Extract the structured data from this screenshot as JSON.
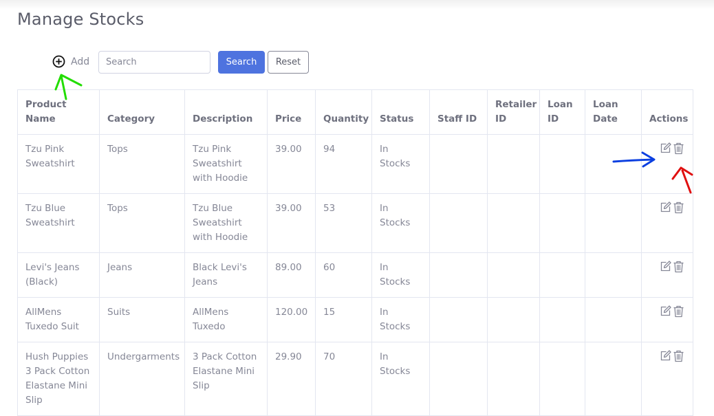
{
  "page": {
    "title": "Manage Stocks"
  },
  "toolbar": {
    "add_label": "Add",
    "search_placeholder": "Search",
    "search_button": "Search",
    "reset_button": "Reset"
  },
  "icons": {
    "add": "plus-circle-icon",
    "edit": "edit-icon",
    "delete": "trash-icon"
  },
  "colors": {
    "primary": "#4e73df",
    "annotation_green": "#22dd00",
    "annotation_blue": "#0b3fe0",
    "annotation_red": "#e01010"
  },
  "table": {
    "headers": {
      "product_name": "Product Name",
      "category": "Category",
      "description": "Description",
      "price": "Price",
      "quantity": "Quantity",
      "status": "Status",
      "staff_id": "Staff ID",
      "retailer_id": "Retailer ID",
      "loan_id": "Loan ID",
      "loan_date": "Loan Date",
      "actions": "Actions"
    },
    "rows": [
      {
        "product_name": "Tzu Pink Sweatshirt",
        "category": "Tops",
        "description": "Tzu Pink Sweatshirt with Hoodie",
        "price": "39.00",
        "quantity": "94",
        "status": "In Stocks",
        "staff_id": "",
        "retailer_id": "",
        "loan_id": "",
        "loan_date": ""
      },
      {
        "product_name": "Tzu Blue Sweatshirt",
        "category": "Tops",
        "description": "Tzu Blue Sweatshirt with Hoodie",
        "price": "39.00",
        "quantity": "53",
        "status": "In Stocks",
        "staff_id": "",
        "retailer_id": "",
        "loan_id": "",
        "loan_date": ""
      },
      {
        "product_name": "Levi's Jeans (Black)",
        "category": "Jeans",
        "description": "Black Levi's Jeans",
        "price": "89.00",
        "quantity": "60",
        "status": "In Stocks",
        "staff_id": "",
        "retailer_id": "",
        "loan_id": "",
        "loan_date": ""
      },
      {
        "product_name": "AllMens Tuxedo Suit",
        "category": "Suits",
        "description": "AllMens Tuxedo",
        "price": "120.00",
        "quantity": "15",
        "status": "In Stocks",
        "staff_id": "",
        "retailer_id": "",
        "loan_id": "",
        "loan_date": ""
      },
      {
        "product_name": "Hush Puppies 3 Pack Cotton Elastane Mini Slip",
        "category": "Undergarments",
        "description": "3 Pack Cotton Elastane Mini Slip",
        "price": "29.90",
        "quantity": "70",
        "status": "In Stocks",
        "staff_id": "",
        "retailer_id": "",
        "loan_id": "",
        "loan_date": ""
      }
    ]
  }
}
